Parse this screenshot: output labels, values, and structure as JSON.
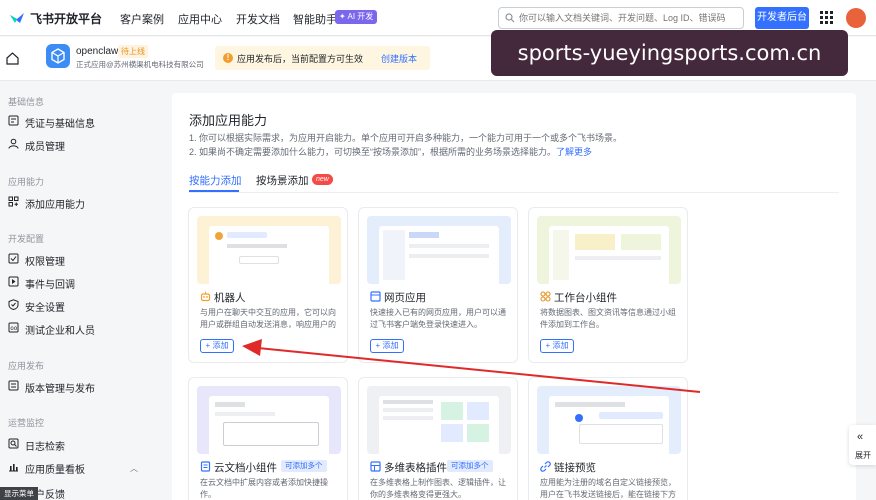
{
  "topnav": {
    "brand": "飞书开放平台",
    "links": [
      "客户案例",
      "应用中心",
      "开发文档",
      "智能助手"
    ],
    "ai_badge": "✦ AI 开发",
    "search_placeholder": "你可以输入文档关键词、开发问题、Log ID、错误码",
    "dev_console_label": "开发者后台"
  },
  "app_header": {
    "app_name": "openclaw",
    "status_badge": "待上线",
    "company": "正式应用@苏州横渠机电科技有限公司",
    "notice_text": "应用发布后，当前配置方可生效",
    "notice_action": "创建版本"
  },
  "watermark": "sports-yueyingsports.com.cn",
  "sidebar": {
    "groups": [
      {
        "title": "基础信息",
        "items": [
          "凭证与基础信息",
          "成员管理"
        ]
      },
      {
        "title": "应用能力",
        "items": [
          "添加应用能力"
        ]
      },
      {
        "title": "开发配置",
        "items": [
          "权限管理",
          "事件与回调",
          "安全设置",
          "测试企业和人员"
        ]
      },
      {
        "title": "应用发布",
        "items": [
          "版本管理与发布"
        ]
      },
      {
        "title": "运营监控",
        "items": [
          "日志检索",
          "应用质量看板",
          "用户反馈"
        ]
      }
    ],
    "active_item": "添加应用能力",
    "tooltip": "显示菜单"
  },
  "main": {
    "title": "添加应用能力",
    "desc_line1": "1. 你可以根据实际需求，为应用开启能力。单个应用可开启多种能力，一个能力可用于一个或多个飞书场景。",
    "desc_line2": "2. 如果尚不确定需要添加什么能力，可切换至“按场景添加”，根据所需的业务场景选择能力。",
    "learn_more": "了解更多",
    "tabs": [
      "按能力添加",
      "按场景添加"
    ],
    "new_badge": "new",
    "add_label": "+ 添加",
    "cards": [
      {
        "title": "机器人",
        "desc": "与用户在聊天中交互的应用，它可以向用户或群组自动发送消息，响应用户的消…",
        "tag": ""
      },
      {
        "title": "网页应用",
        "desc": "快速接入已有的网页应用，用户可以通过飞书客户端免登录快速进入。",
        "tag": ""
      },
      {
        "title": "工作台小组件",
        "desc": "将数据图表、图文资讯等信息通过小组件添加到工作台。",
        "tag": ""
      },
      {
        "title": "云文档小组件",
        "desc": "在云文档中扩展内容或者添加快捷操作。",
        "tag": "可添加多个"
      },
      {
        "title": "多维表格插件",
        "desc": "在多维表格上制作图表、逻辑插件，让你的多维表格变得更强大。",
        "tag": "可添加多个"
      },
      {
        "title": "链接预览",
        "desc": "应用能为注册的域名自定义链接预览，用户在飞书发送链接后，能在链接下方展…",
        "tag": ""
      }
    ]
  },
  "expand_tab": {
    "label": "展开"
  },
  "colors": {
    "accent": "#3370ff",
    "arrow": "#e02a2a",
    "watermark_bg": "#44283b"
  }
}
